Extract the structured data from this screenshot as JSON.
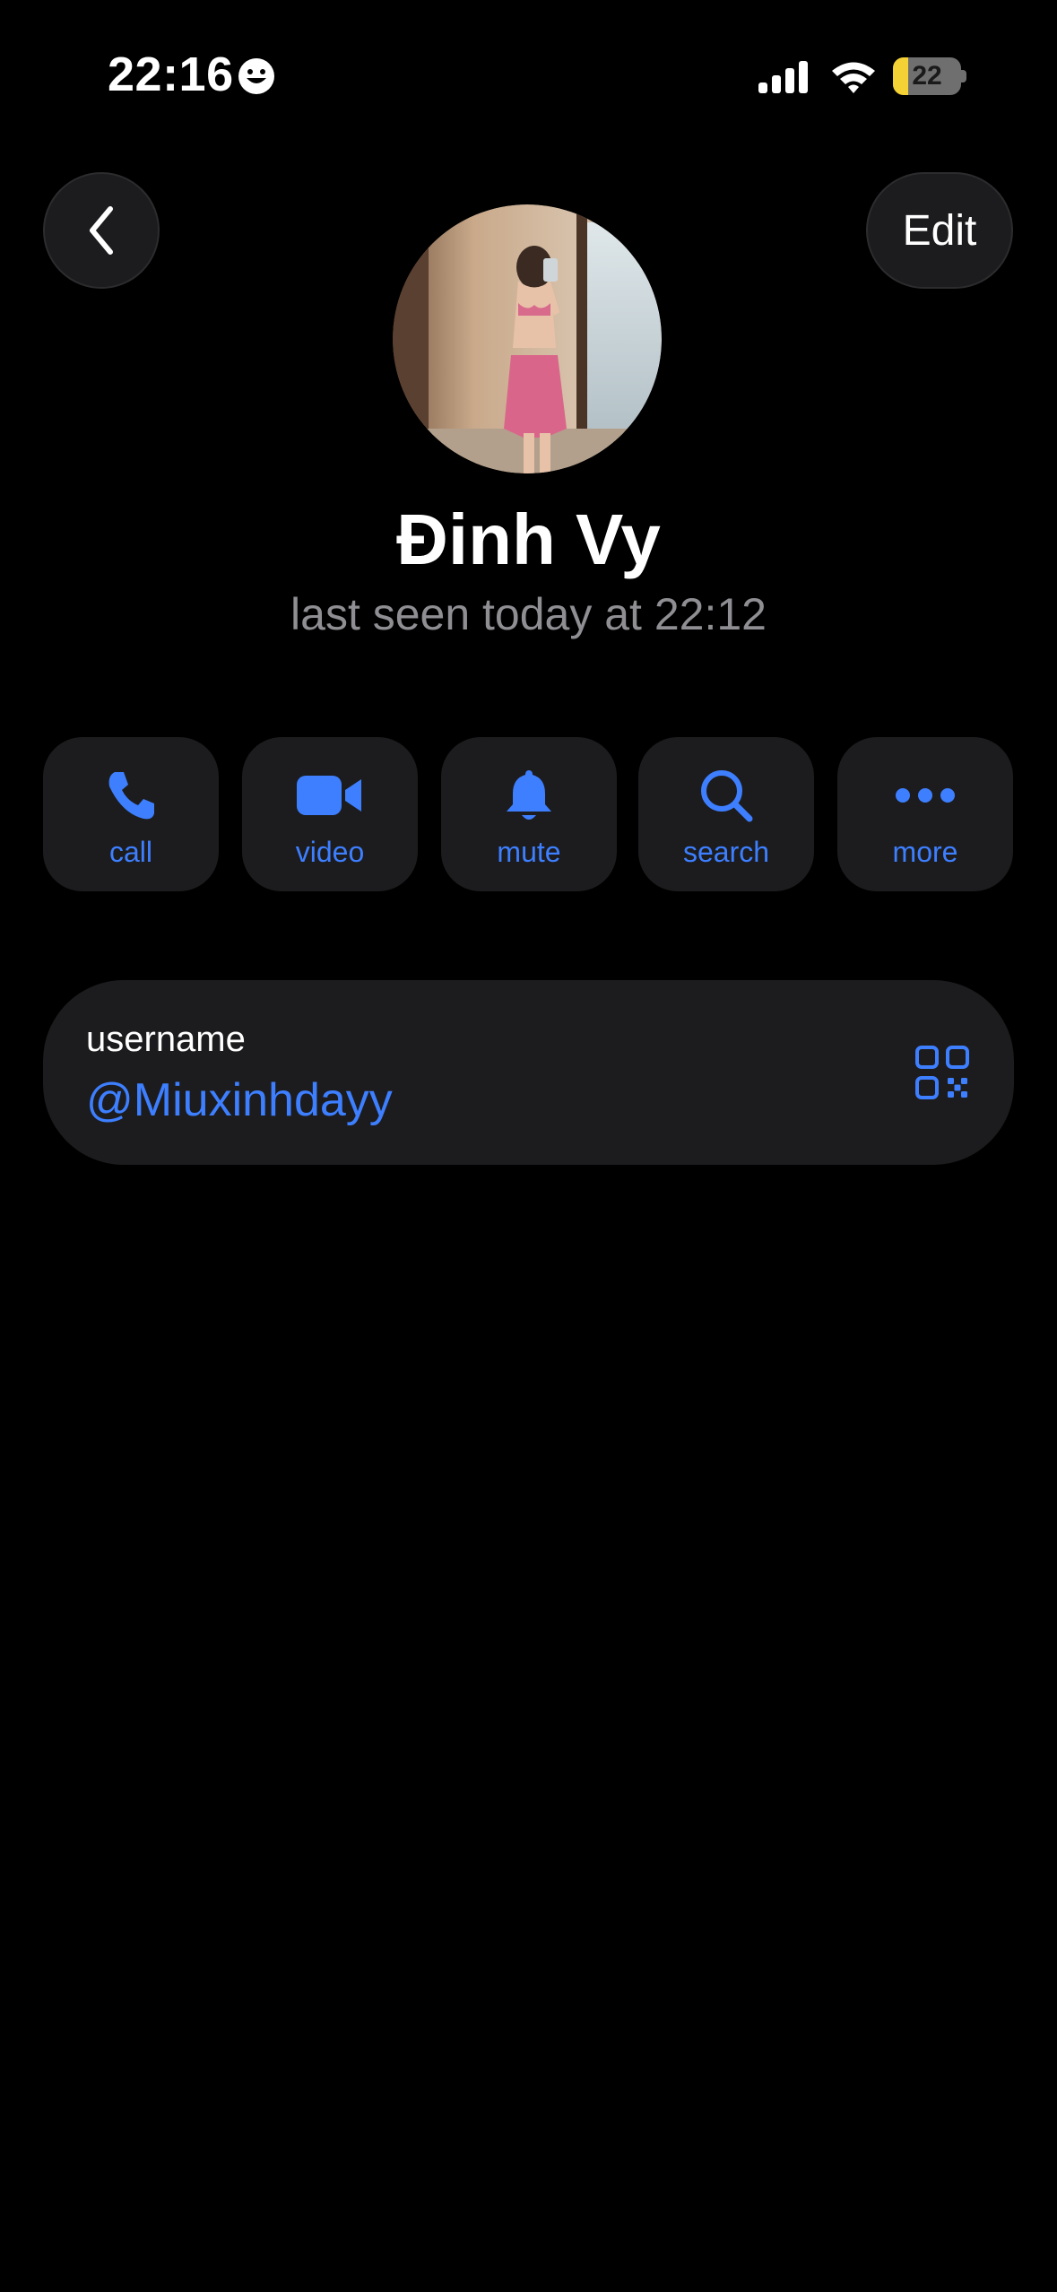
{
  "status_bar": {
    "time": "22:16",
    "battery": "22",
    "battery_level_percent": 22,
    "icons": [
      "smiley-icon",
      "cellular-signal-icon",
      "wifi-icon",
      "battery-charging-icon"
    ]
  },
  "nav": {
    "back_icon": "chevron-left-icon",
    "edit_label": "Edit"
  },
  "profile": {
    "name": "Đinh Vy",
    "status": "last seen today at 22:12"
  },
  "actions": [
    {
      "label": "call",
      "icon": "phone-icon"
    },
    {
      "label": "video",
      "icon": "video-camera-icon"
    },
    {
      "label": "mute",
      "icon": "bell-icon"
    },
    {
      "label": "search",
      "icon": "search-icon"
    },
    {
      "label": "more",
      "icon": "ellipsis-icon"
    }
  ],
  "info": {
    "username_label": "username",
    "username_value": "@Miuxinhdayy",
    "qr_icon": "qr-code-icon"
  },
  "colors": {
    "background": "#000000",
    "card": "#1c1c1e",
    "accent": "#3d7fff",
    "secondary_text": "#8e8e93",
    "battery_fill": "#f4d235"
  }
}
